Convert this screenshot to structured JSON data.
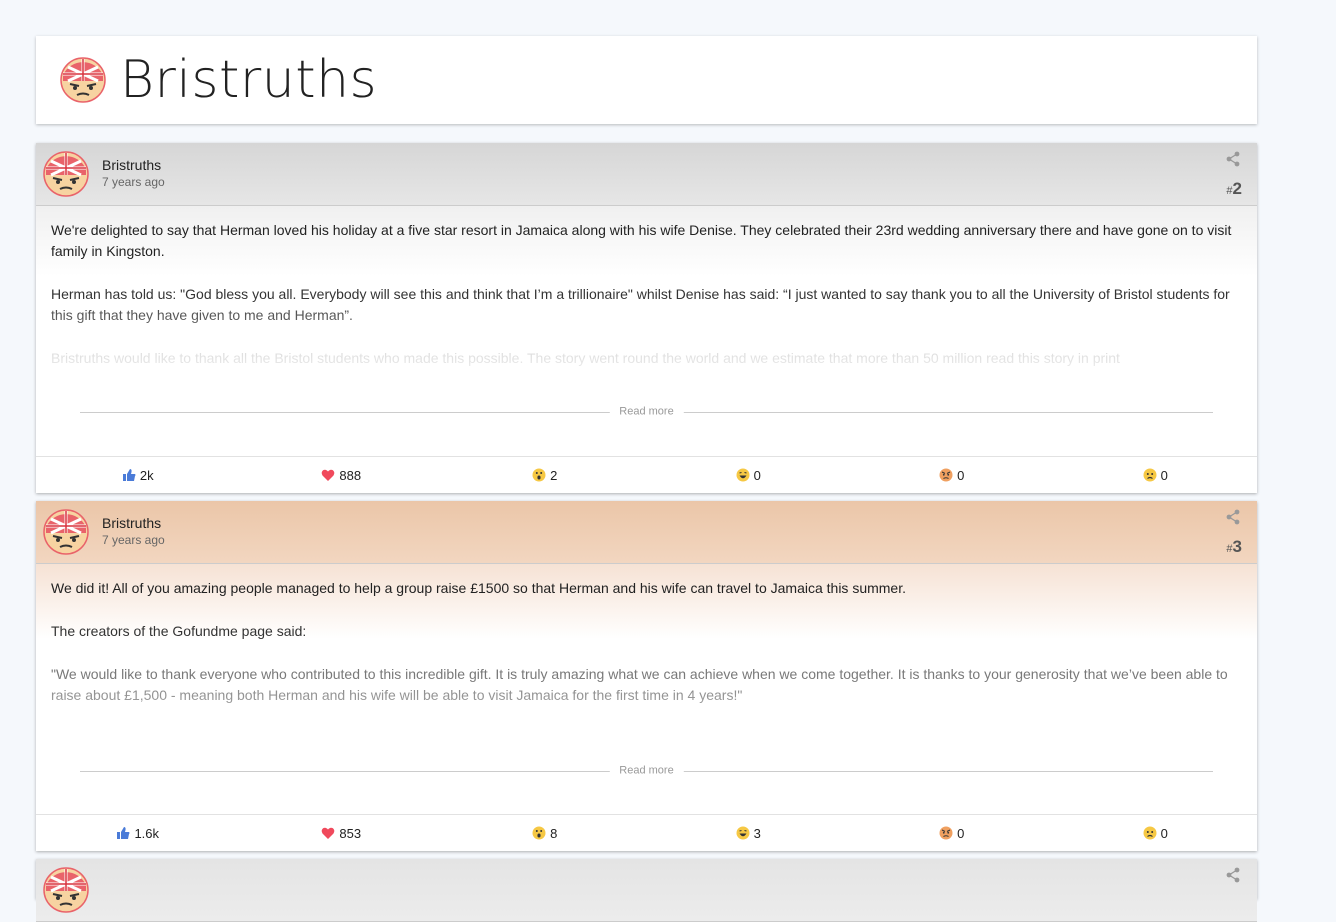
{
  "site": {
    "title": "Bristruths"
  },
  "posts": [
    {
      "author": "Bristruths",
      "time": "7 years ago",
      "number": "2",
      "header_tint": "#dcdcdc",
      "paragraphs": [
        "We're delighted to say that Herman loved his holiday at a five star resort in Jamaica along with his wife Denise. They celebrated their 23rd wedding anniversary there and have gone on to visit family in Kingston.",
        "Herman has told us: \"God bless you all. Everybody will see this and think that I’m a trillionaire\" whilst Denise has said: “I just wanted to say thank you to all the University of Bristol students for this gift that they have given to me and Herman”.",
        "Bristruths would like to thank all the Bristol students who made this possible. The story went round the world and we estimate that more than 50 million read this story in print"
      ],
      "read_more": "Read more",
      "reactions": {
        "like": "2k",
        "love": "888",
        "wow": "2",
        "haha": "0",
        "angry": "0",
        "sad": "0"
      }
    },
    {
      "author": "Bristruths",
      "time": "7 years ago",
      "number": "3",
      "header_tint": "#ecc9ad",
      "paragraphs": [
        "We did it! All of you amazing people managed to help a group raise £1500 so that Herman and his wife can travel to Jamaica this summer.",
        "The creators of the Gofundme page said:",
        "\"We would like to thank everyone who contributed to this incredible gift. It is truly amazing what we can achieve when we come together. It is thanks to your generosity that we’ve been able to raise about £1,500 - meaning both Herman and his wife will be able to visit Jamaica for the first time in 4 years!\""
      ],
      "read_more": "Read more",
      "reactions": {
        "like": "1.6k",
        "love": "853",
        "wow": "8",
        "haha": "3",
        "angry": "0",
        "sad": "0"
      }
    }
  ],
  "icons": {
    "logo": "angry-face-union-jack-icon",
    "share": "share-icon",
    "like": "thumbs-up-icon",
    "love": "heart-icon",
    "wow": "wow-face-icon",
    "haha": "laugh-face-icon",
    "angry": "angry-face-icon",
    "sad": "sad-face-icon"
  },
  "colors": {
    "like": "#4a7bd8",
    "love": "#f0495c",
    "emoji": "#f6c844"
  }
}
